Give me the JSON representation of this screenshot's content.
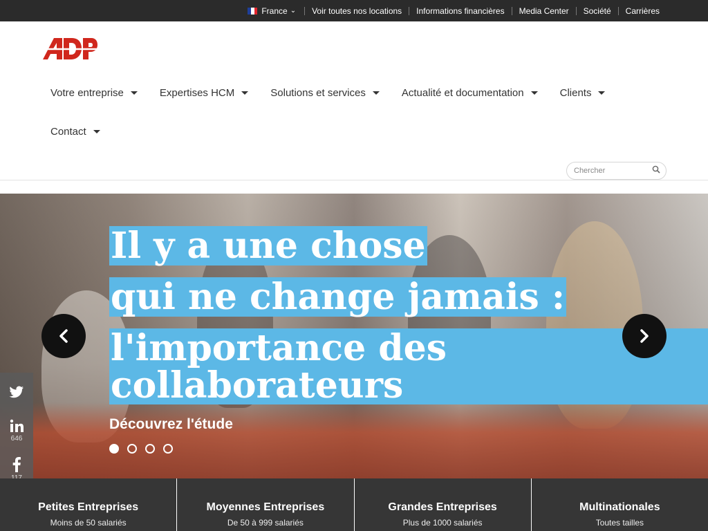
{
  "topbar": {
    "country": "France",
    "links": [
      "Voir toutes nos locations",
      "Informations financières",
      "Media Center",
      "Société",
      "Carrières"
    ]
  },
  "brand": {
    "logo_text": "ADP",
    "color": "#d0271d"
  },
  "nav": {
    "row1": [
      "Votre entreprise",
      "Expertises HCM",
      "Solutions et services",
      "Actualité et documentation",
      "Clients"
    ],
    "row2": [
      "Contact"
    ]
  },
  "search": {
    "placeholder": "Chercher"
  },
  "hero": {
    "headline_lines": [
      "Il y a une chose",
      "qui ne change jamais :",
      "l'importance des",
      "collaborateurs"
    ],
    "cta": "Découvrez l'étude",
    "slide_count": 4,
    "active_slide": 1,
    "highlight_color": "#5cb8e6"
  },
  "social": {
    "twitter": {
      "icon": "twitter-icon"
    },
    "linkedin": {
      "icon": "linkedin-icon",
      "count": "646"
    },
    "facebook": {
      "icon": "facebook-icon",
      "count": "117"
    },
    "email": {
      "icon": "email-icon"
    }
  },
  "segments": [
    {
      "title": "Petites Entreprises",
      "subtitle": "Moins de 50 salariés"
    },
    {
      "title": "Moyennes Entreprises",
      "subtitle": "De 50 à 999 salariés"
    },
    {
      "title": "Grandes Entreprises",
      "subtitle": "Plus de 1000 salariés"
    },
    {
      "title": "Multinationales",
      "subtitle": "Toutes tailles"
    }
  ]
}
